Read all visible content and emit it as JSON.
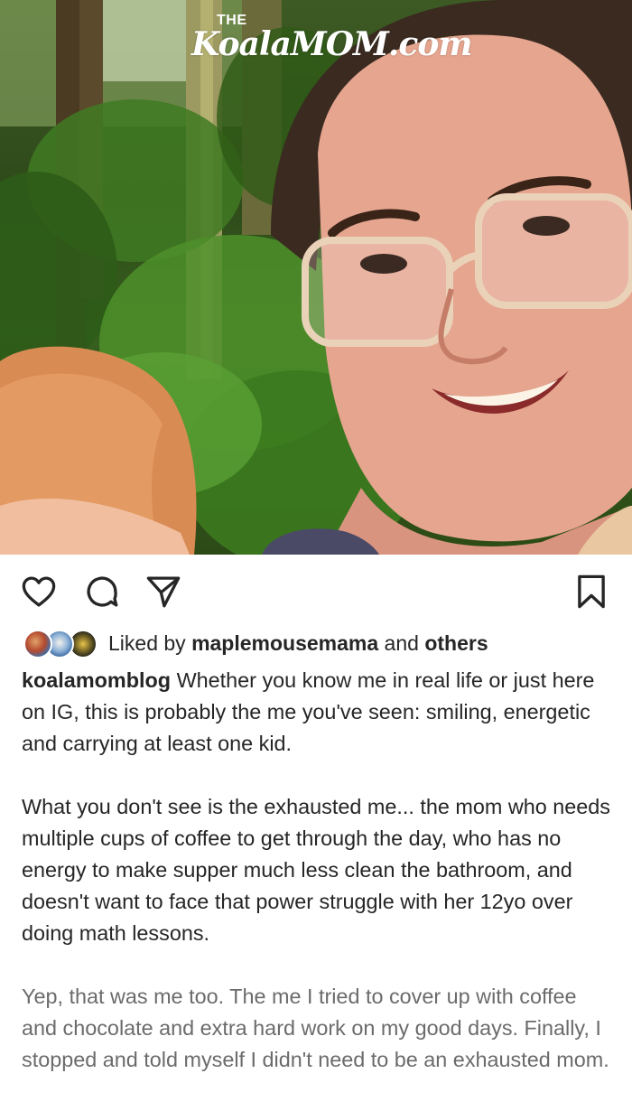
{
  "watermark": {
    "the": "THE",
    "brand": "KoalaMOM.com"
  },
  "photo": {
    "alt": "Smiling mom in clear glasses with a red-haired toddler in the forest"
  },
  "actions": {
    "like_icon": "heart-icon",
    "comment_icon": "comment-bubble-icon",
    "share_icon": "paper-plane-icon",
    "save_icon": "bookmark-icon"
  },
  "likes": {
    "prefix": "Liked by",
    "user": "maplemousemama",
    "conjunction": "and",
    "others": "others"
  },
  "caption": {
    "username": "koalamomblog",
    "paragraphs": [
      "Whether you know me in real life or just here on IG, this is probably the me you've seen: smiling, energetic and carrying at least one kid.",
      "What you don't see is the exhausted me... the mom who needs multiple cups of coffee to get through the day, who has no energy to make supper much less clean the bathroom, and doesn't want to face that power struggle with her 12yo over doing math lessons.",
      "Yep, that was me too. The me I tried to cover up with coffee and chocolate and extra hard work on my good days. Finally, I stopped and told myself I didn't need to be an exhausted mom."
    ]
  },
  "colors": {
    "text": "#262626",
    "muted": "#6b6b6b",
    "background": "#ffffff"
  }
}
